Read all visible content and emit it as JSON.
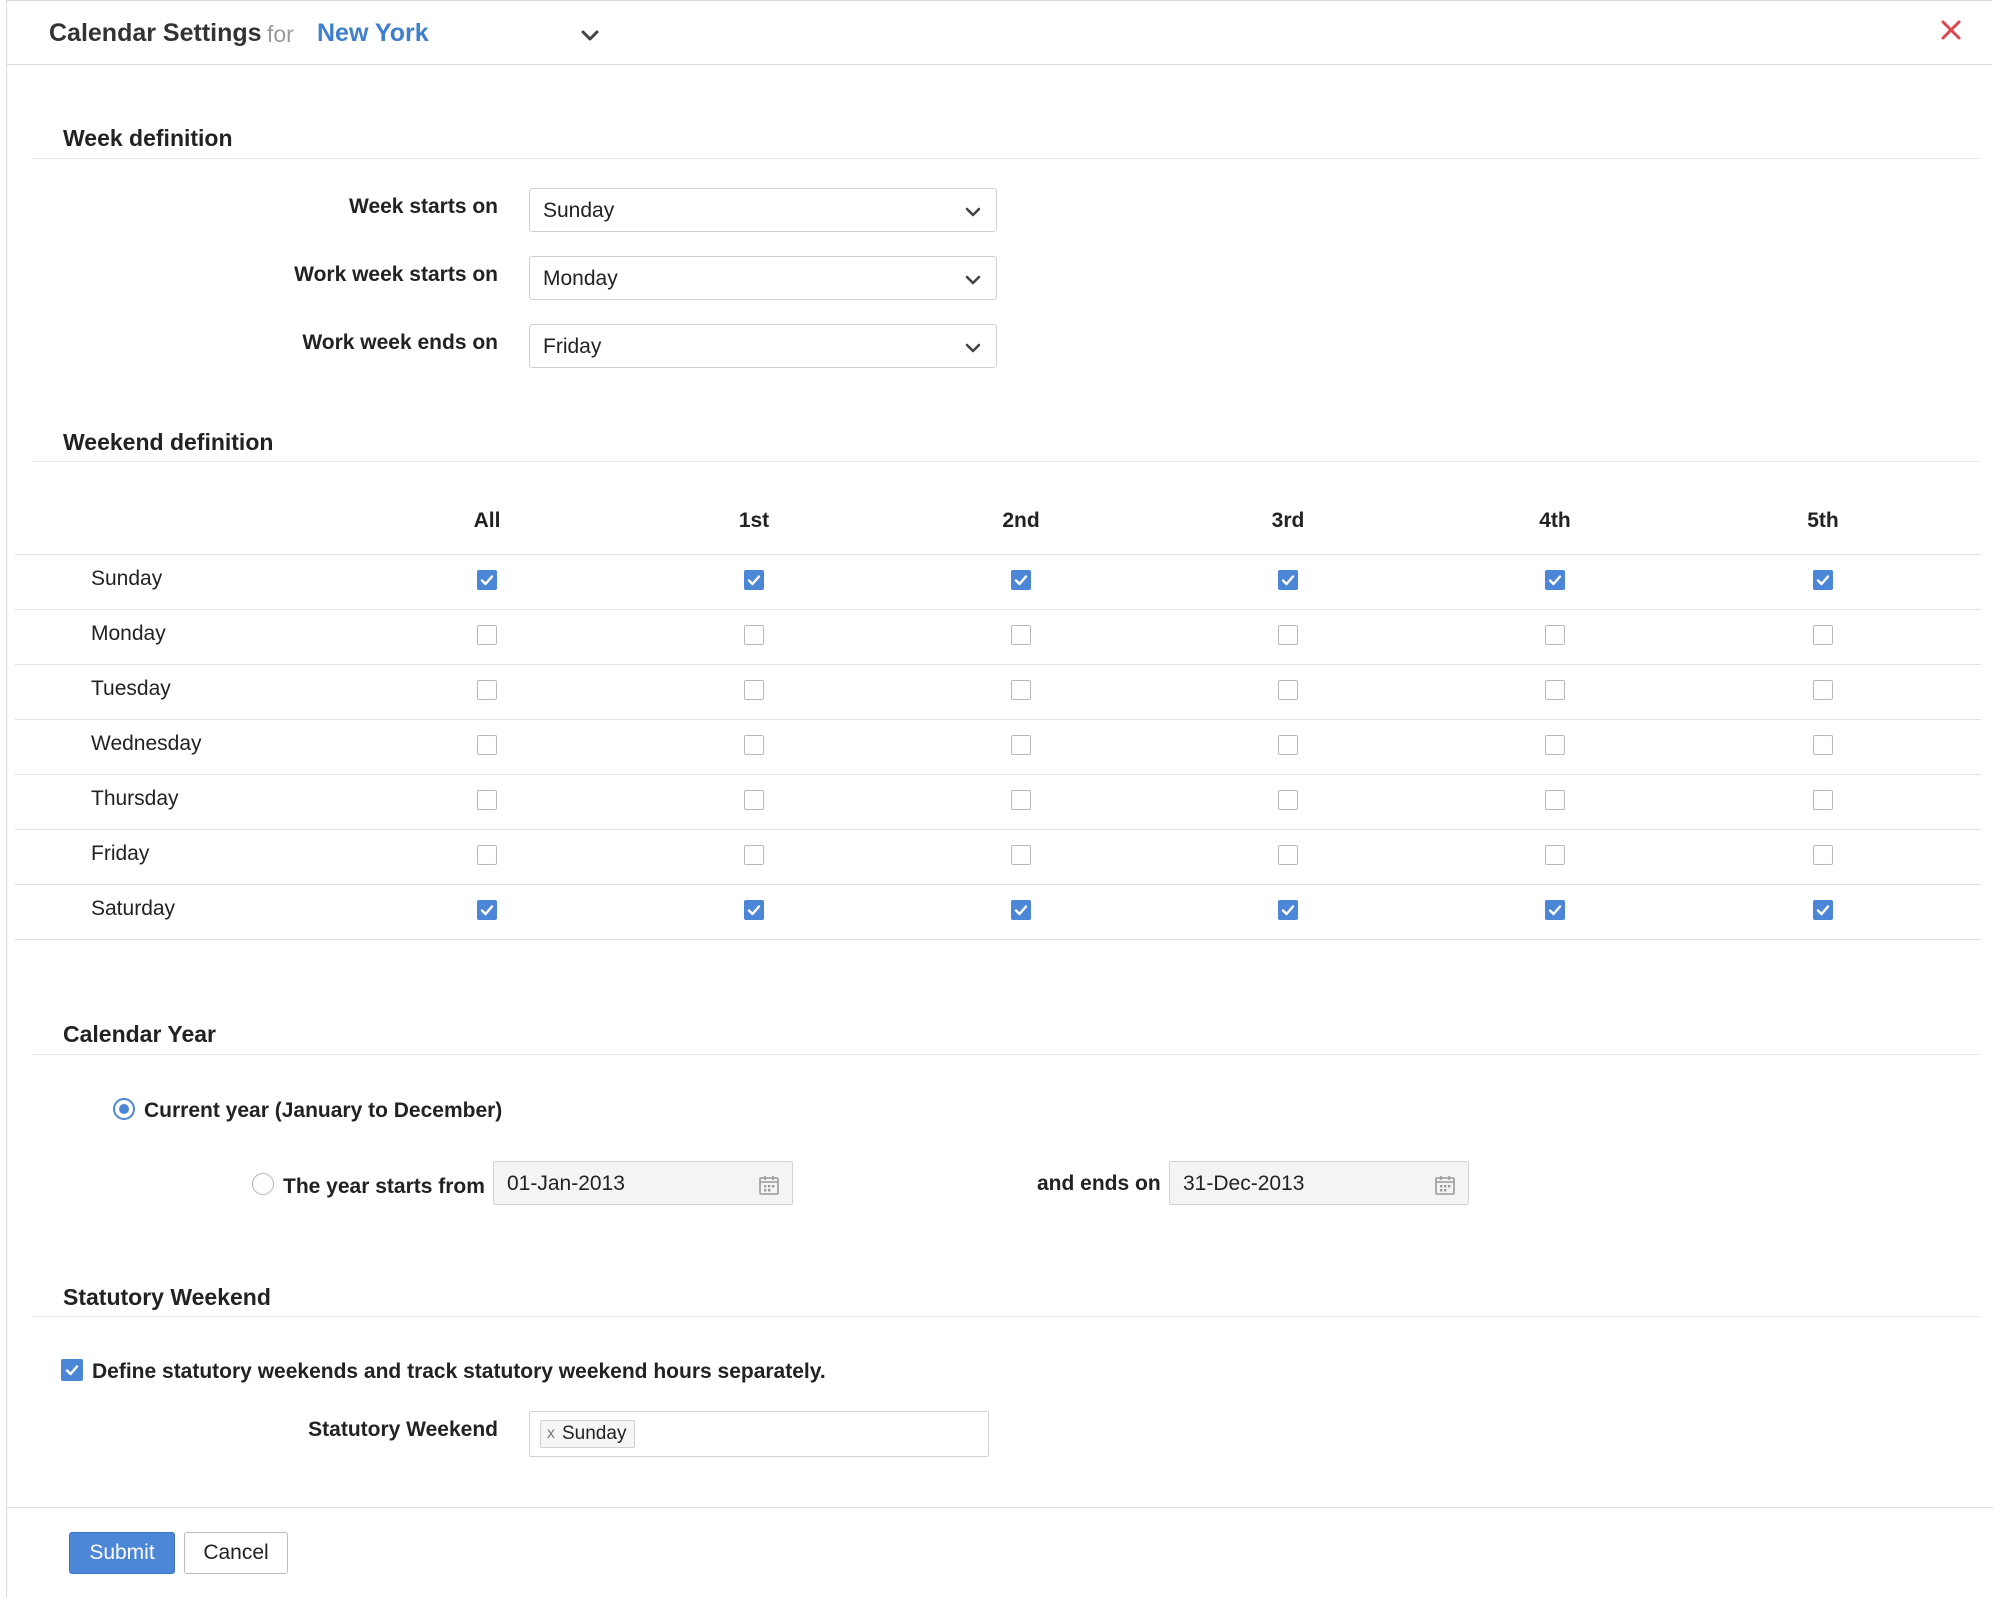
{
  "header": {
    "title": "Calendar Settings",
    "for_label": "for",
    "location": "New York"
  },
  "week_definition": {
    "title": "Week definition",
    "fields": [
      {
        "label": "Week starts on",
        "value": "Sunday"
      },
      {
        "label": "Work week starts on",
        "value": "Monday"
      },
      {
        "label": "Work week ends on",
        "value": "Friday"
      }
    ]
  },
  "weekend_definition": {
    "title": "Weekend definition",
    "columns": [
      "All",
      "1st",
      "2nd",
      "3rd",
      "4th",
      "5th"
    ],
    "rows": [
      {
        "day": "Sunday",
        "checks": [
          true,
          true,
          true,
          true,
          true,
          true
        ]
      },
      {
        "day": "Monday",
        "checks": [
          false,
          false,
          false,
          false,
          false,
          false
        ]
      },
      {
        "day": "Tuesday",
        "checks": [
          false,
          false,
          false,
          false,
          false,
          false
        ]
      },
      {
        "day": "Wednesday",
        "checks": [
          false,
          false,
          false,
          false,
          false,
          false
        ]
      },
      {
        "day": "Thursday",
        "checks": [
          false,
          false,
          false,
          false,
          false,
          false
        ]
      },
      {
        "day": "Friday",
        "checks": [
          false,
          false,
          false,
          false,
          false,
          false
        ]
      },
      {
        "day": "Saturday",
        "checks": [
          true,
          true,
          true,
          true,
          true,
          true
        ]
      }
    ]
  },
  "calendar_year": {
    "title": "Calendar Year",
    "current_year_label": "Current year (January to December)",
    "current_year_selected": true,
    "custom_label": "The year starts from",
    "custom_selected": false,
    "start_date": "01-Jan-2013",
    "ends_label": "and ends on",
    "end_date": "31-Dec-2013"
  },
  "statutory_weekend": {
    "title": "Statutory Weekend",
    "define_label": "Define statutory weekends and track statutory weekend hours separately.",
    "define_checked": true,
    "field_label": "Statutory Weekend",
    "tags": [
      "Sunday"
    ],
    "tag_remove_glyph": "x"
  },
  "footer": {
    "submit_label": "Submit",
    "cancel_label": "Cancel"
  },
  "colors": {
    "accent": "#4c86d6",
    "link": "#3f7fd0",
    "close": "#e0474c"
  }
}
